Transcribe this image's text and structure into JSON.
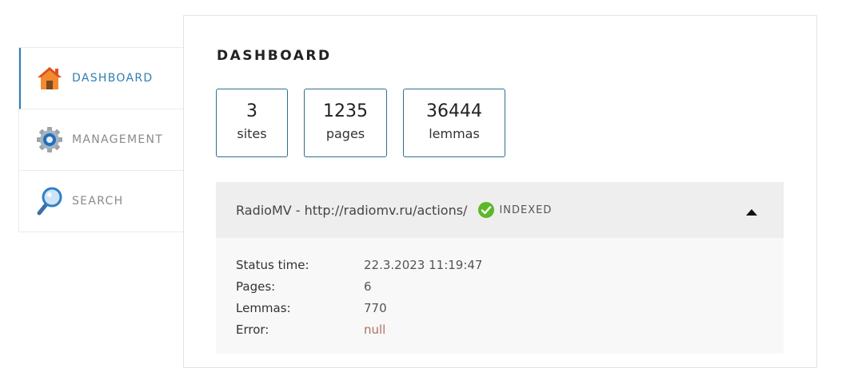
{
  "sidebar": {
    "items": [
      {
        "label": "DASHBOARD",
        "icon": "home-icon",
        "active": true
      },
      {
        "label": "MANAGEMENT",
        "icon": "gear-icon",
        "active": false
      },
      {
        "label": "SEARCH",
        "icon": "magnifier-icon",
        "active": false
      }
    ]
  },
  "main": {
    "title": "DASHBOARD",
    "stats": [
      {
        "value": "3",
        "label": "sites"
      },
      {
        "value": "1235",
        "label": "pages"
      },
      {
        "value": "36444",
        "label": "lemmas"
      }
    ],
    "site": {
      "name": "RadioMV - http://radiomv.ru/actions/",
      "status": "INDEXED",
      "details": [
        {
          "key": "Status time:",
          "value": "22.3.2023 11:19:47"
        },
        {
          "key": "Pages:",
          "value": "6"
        },
        {
          "key": "Lemmas:",
          "value": "770"
        },
        {
          "key": "Error:",
          "value": "null"
        }
      ]
    }
  },
  "colors": {
    "accent": "#2f7fb0",
    "stat_border": "#2f6f90",
    "indexed_green": "#5cb82a",
    "error_text": "#b0705a"
  }
}
